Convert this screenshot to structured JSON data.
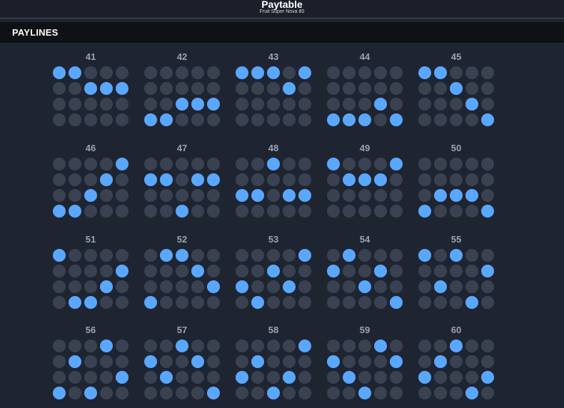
{
  "header": {
    "title": "Paytable",
    "subtitle": "Fruit Super Nova 80"
  },
  "section": {
    "title": "PAYLINES"
  },
  "colors": {
    "background": "#1f2431",
    "header_bar": "#0f1115",
    "dot_inactive": "#3a4252",
    "dot_active": "#5aa7ff",
    "number": "#9aa3b5"
  },
  "paylines": [
    {
      "number": "41",
      "rows": [
        0,
        1,
        2,
        3
      ],
      "active": [
        [
          0,
          0
        ],
        [
          1,
          0
        ],
        [
          2,
          1
        ],
        [
          3,
          1
        ],
        [
          4,
          1
        ]
      ]
    },
    {
      "number": "42",
      "active": [
        [
          0,
          3
        ],
        [
          1,
          3
        ],
        [
          2,
          2
        ],
        [
          3,
          2
        ],
        [
          4,
          2
        ]
      ]
    },
    {
      "number": "43",
      "active": [
        [
          0,
          0
        ],
        [
          1,
          0
        ],
        [
          2,
          0
        ],
        [
          3,
          1
        ],
        [
          4,
          0
        ]
      ]
    },
    {
      "number": "44",
      "active": [
        [
          0,
          3
        ],
        [
          1,
          3
        ],
        [
          2,
          3
        ],
        [
          3,
          2
        ],
        [
          4,
          3
        ]
      ]
    },
    {
      "number": "45",
      "active": [
        [
          0,
          0
        ],
        [
          1,
          0
        ],
        [
          2,
          1
        ],
        [
          3,
          2
        ],
        [
          4,
          3
        ]
      ]
    },
    {
      "number": "46",
      "active": [
        [
          0,
          3
        ],
        [
          1,
          3
        ],
        [
          2,
          2
        ],
        [
          3,
          1
        ],
        [
          4,
          0
        ]
      ]
    },
    {
      "number": "47",
      "active": [
        [
          0,
          1
        ],
        [
          1,
          1
        ],
        [
          2,
          3
        ],
        [
          3,
          1
        ],
        [
          4,
          1
        ]
      ]
    },
    {
      "number": "48",
      "active": [
        [
          0,
          2
        ],
        [
          1,
          2
        ],
        [
          2,
          0
        ],
        [
          3,
          2
        ],
        [
          4,
          2
        ]
      ]
    },
    {
      "number": "49",
      "active": [
        [
          0,
          0
        ],
        [
          1,
          1
        ],
        [
          2,
          1
        ],
        [
          3,
          1
        ],
        [
          4,
          0
        ]
      ]
    },
    {
      "number": "50",
      "active": [
        [
          0,
          3
        ],
        [
          1,
          2
        ],
        [
          2,
          2
        ],
        [
          3,
          2
        ],
        [
          4,
          3
        ]
      ]
    },
    {
      "number": "51",
      "active": [
        [
          0,
          0
        ],
        [
          1,
          3
        ],
        [
          2,
          3
        ],
        [
          3,
          2
        ],
        [
          4,
          1
        ]
      ]
    },
    {
      "number": "52",
      "active": [
        [
          0,
          3
        ],
        [
          1,
          0
        ],
        [
          2,
          0
        ],
        [
          3,
          1
        ],
        [
          4,
          2
        ]
      ]
    },
    {
      "number": "53",
      "active": [
        [
          0,
          2
        ],
        [
          1,
          3
        ],
        [
          2,
          1
        ],
        [
          3,
          2
        ],
        [
          4,
          0
        ]
      ]
    },
    {
      "number": "54",
      "active": [
        [
          0,
          1
        ],
        [
          1,
          0
        ],
        [
          2,
          2
        ],
        [
          3,
          1
        ],
        [
          4,
          3
        ]
      ]
    },
    {
      "number": "55",
      "active": [
        [
          0,
          0
        ],
        [
          1,
          2
        ],
        [
          2,
          0
        ],
        [
          3,
          3
        ],
        [
          4,
          1
        ]
      ]
    },
    {
      "number": "56",
      "active": [
        [
          0,
          3
        ],
        [
          1,
          1
        ],
        [
          2,
          3
        ],
        [
          3,
          0
        ],
        [
          4,
          2
        ]
      ]
    },
    {
      "number": "57",
      "active": [
        [
          0,
          1
        ],
        [
          1,
          2
        ],
        [
          2,
          0
        ],
        [
          3,
          1
        ],
        [
          4,
          3
        ]
      ]
    },
    {
      "number": "58",
      "active": [
        [
          0,
          2
        ],
        [
          1,
          1
        ],
        [
          2,
          3
        ],
        [
          3,
          2
        ],
        [
          4,
          0
        ]
      ]
    },
    {
      "number": "59",
      "active": [
        [
          0,
          1
        ],
        [
          1,
          2
        ],
        [
          2,
          3
        ],
        [
          3,
          0
        ],
        [
          4,
          1
        ]
      ]
    },
    {
      "number": "60",
      "active": [
        [
          0,
          2
        ],
        [
          1,
          1
        ],
        [
          2,
          0
        ],
        [
          3,
          3
        ],
        [
          4,
          2
        ]
      ]
    }
  ]
}
